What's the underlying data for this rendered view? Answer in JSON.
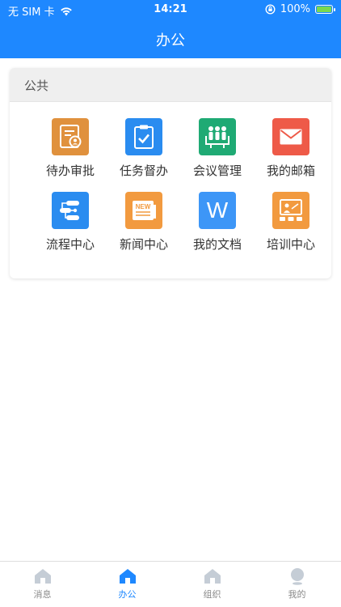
{
  "status_bar": {
    "carrier": "无 SIM 卡",
    "time": "14:21",
    "battery": "100%"
  },
  "header": {
    "title": "办公"
  },
  "section": {
    "title": "公共",
    "items": [
      {
        "label": "待办审批",
        "icon": "approval-doc-icon",
        "color": "#e0913d"
      },
      {
        "label": "任务督办",
        "icon": "clipboard-check-icon",
        "color": "#2a8cf0"
      },
      {
        "label": "会议管理",
        "icon": "meeting-people-icon",
        "color": "#1faa74"
      },
      {
        "label": "我的邮箱",
        "icon": "mail-icon",
        "color": "#ee5a48"
      },
      {
        "label": "流程中心",
        "icon": "flow-icon",
        "color": "#2a8cf0"
      },
      {
        "label": "新闻中心",
        "icon": "news-icon",
        "color": "#f29a3f",
        "badge": "NEW"
      },
      {
        "label": "我的文档",
        "icon": "document-w-icon",
        "color": "#3d96f7",
        "glyph": "W"
      },
      {
        "label": "培训中心",
        "icon": "training-board-icon",
        "color": "#f29a3f"
      }
    ]
  },
  "tabs": [
    {
      "label": "消息",
      "icon": "home-icon",
      "active": false
    },
    {
      "label": "办公",
      "icon": "home-icon",
      "active": true
    },
    {
      "label": "组织",
      "icon": "home-icon",
      "active": false
    },
    {
      "label": "我的",
      "icon": "user-icon",
      "active": false
    }
  ],
  "colors": {
    "primary": "#1e88ff",
    "tab_inactive": "#c5cdd6"
  }
}
